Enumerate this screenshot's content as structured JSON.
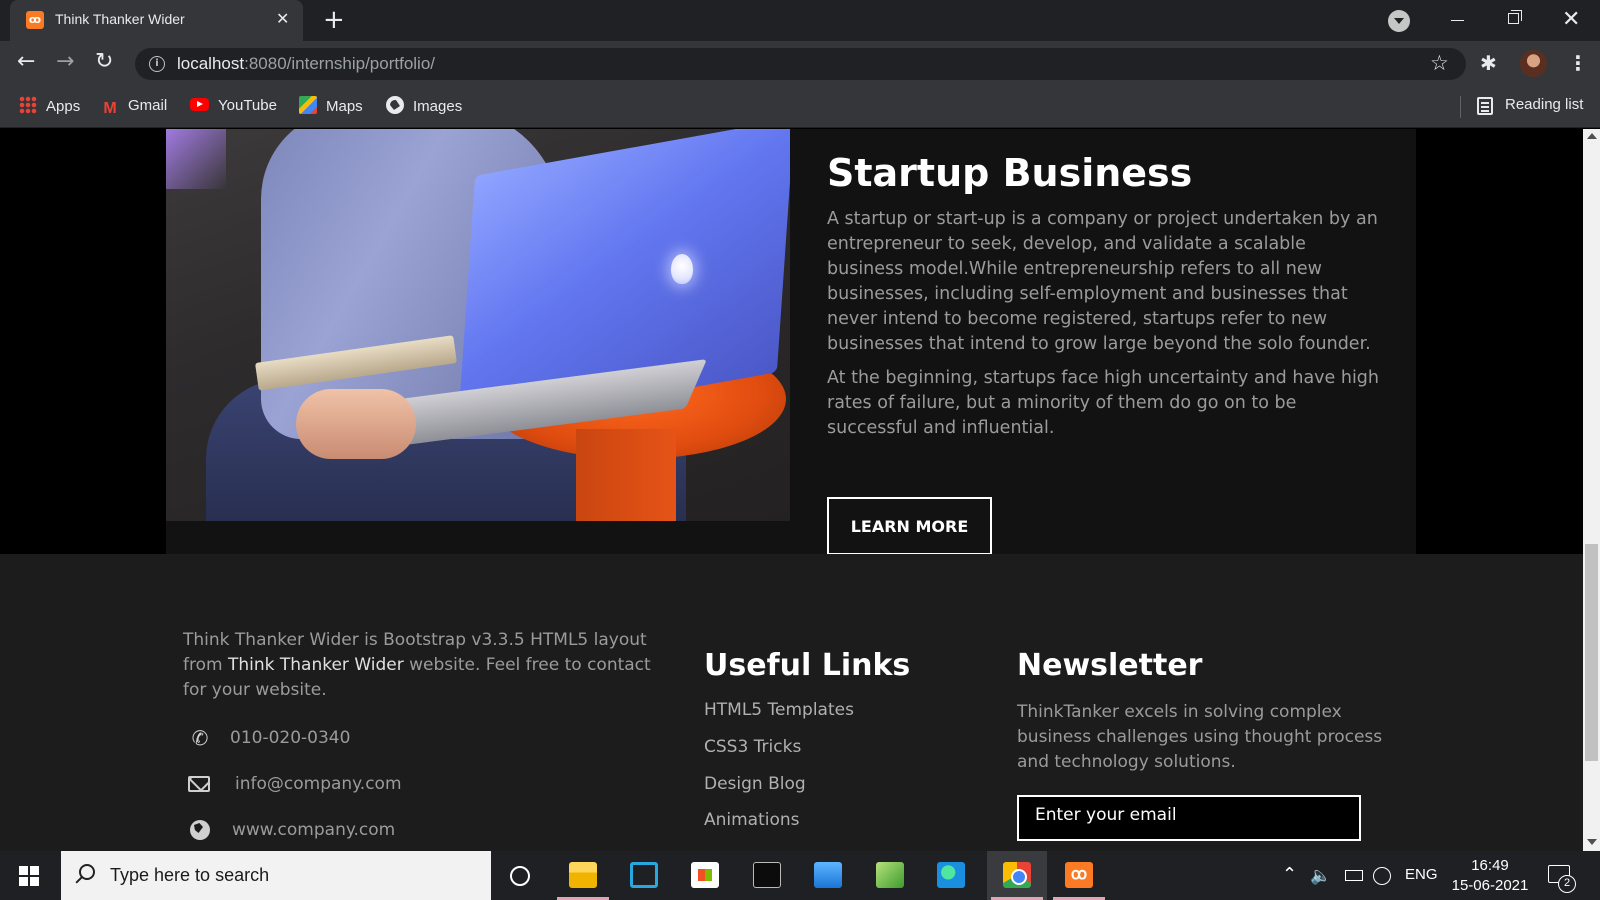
{
  "browser": {
    "tab_title": "Think Thanker Wider",
    "url_host": "localhost",
    "url_rest": ":8080/internship/portfolio/",
    "bookmarks": [
      {
        "label": "Apps",
        "icon": "apps-icon"
      },
      {
        "label": "Gmail",
        "icon": "gmail-icon"
      },
      {
        "label": "YouTube",
        "icon": "youtube-icon"
      },
      {
        "label": "Maps",
        "icon": "maps-icon"
      },
      {
        "label": "Images",
        "icon": "images-icon"
      }
    ],
    "reading_list": "Reading list"
  },
  "feature": {
    "title": "Startup Business",
    "paragraph1": "A startup or start-up is a company or project undertaken by an entrepreneur to seek, develop, and validate a scalable business model.While entrepreneurship refers to all new businesses, including self-employment and businesses that never intend to become registered, startups refer to new businesses that intend to grow large beyond the solo founder.",
    "paragraph2": "At the beginning, startups face high uncertainty and have high rates of failure, but a minority of them do go on to be successful and influential.",
    "button": "LEARN MORE"
  },
  "footer": {
    "about_pre": "Think Thanker Wider is Bootstrap v3.3.5 HTML5 layout from ",
    "about_brand": "Think Thanker Wider",
    "about_post": " website. Feel free to contact for your website.",
    "phone": "010-020-0340",
    "email": "info@company.com",
    "website": "www.company.com",
    "links_title": "Useful Links",
    "links": [
      "HTML5 Templates",
      "CSS3 Tricks",
      "Design Blog",
      "Animations"
    ],
    "newsletter_title": "Newsletter",
    "newsletter_text": "ThinkTanker excels in solving complex business challenges using thought process and technology solutions.",
    "email_placeholder": "Enter your email"
  },
  "taskbar": {
    "search_placeholder": "Type here to search",
    "language": "ENG",
    "time": "16:49",
    "date": "15-06-2021",
    "notification_count": "2"
  },
  "colors": {
    "page_bg": "#000000",
    "feature_bg": "#121212",
    "footer_bg": "#1c1c1c",
    "accent_orange": "#fb7a24"
  }
}
